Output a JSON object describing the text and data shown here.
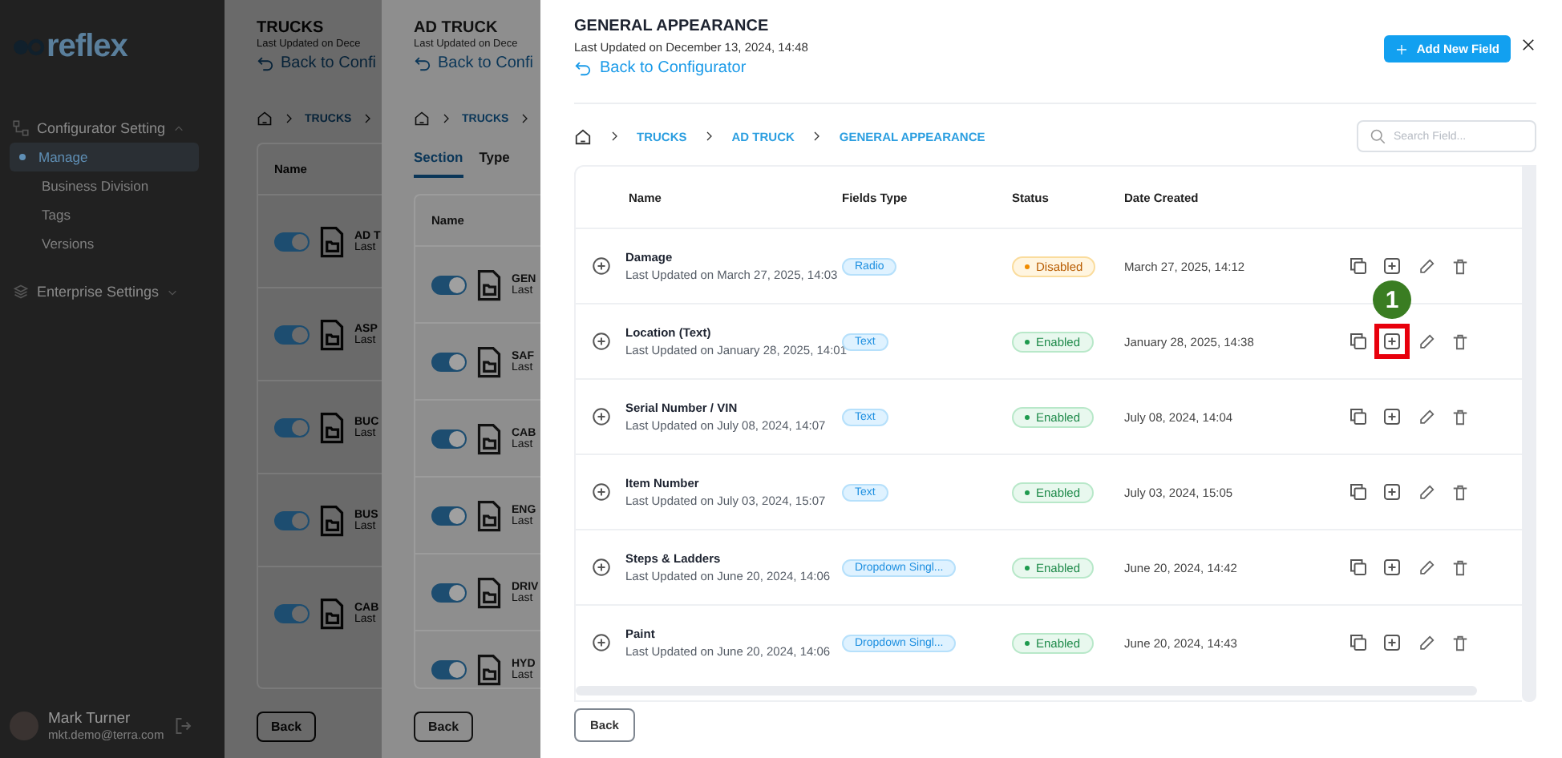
{
  "sidebar": {
    "logo_text": "reflex",
    "groups": [
      {
        "label": "Configurator Setting",
        "expanded": true,
        "items": [
          {
            "label": "Manage",
            "selected": true
          },
          {
            "label": "Business Division",
            "selected": false
          },
          {
            "label": "Tags",
            "selected": false
          },
          {
            "label": "Versions",
            "selected": false
          }
        ]
      },
      {
        "label": "Enterprise Settings",
        "expanded": false
      }
    ],
    "user": {
      "name": "Mark Turner",
      "email": "mkt.demo@terra.com"
    }
  },
  "back_panels": [
    {
      "title": "TRUCKS",
      "subtitle": "Last Updated on Dece",
      "back_link": "Back to Confi",
      "breadcrumb": [
        "TRUCKS"
      ],
      "column": "Name",
      "rows": [
        {
          "name": "AD T",
          "sub": "Last",
          "on": true
        },
        {
          "name": "ASP",
          "sub": "Last",
          "on": true
        },
        {
          "name": "BUC",
          "sub": "Last",
          "on": true
        },
        {
          "name": "BUS",
          "sub": "Last",
          "on": true
        },
        {
          "name": "CAB",
          "sub": "Last",
          "on": true
        }
      ],
      "back_button": "Back"
    },
    {
      "title": "AD TRUCK",
      "subtitle": "Last Updated on Dece",
      "back_link": "Back to Confi",
      "breadcrumb": [
        "TRUCKS"
      ],
      "tabs": [
        {
          "label": "Section",
          "selected": true
        },
        {
          "label": "Type",
          "selected": false
        }
      ],
      "column": "Name",
      "rows": [
        {
          "name": "GEN",
          "sub": "Last",
          "on": true
        },
        {
          "name": "SAF",
          "sub": "Last",
          "on": true
        },
        {
          "name": "CAB",
          "sub": "Last",
          "on": true
        },
        {
          "name": "ENG",
          "sub": "Last",
          "on": true
        },
        {
          "name": "DRIV",
          "sub": "Last",
          "on": true
        },
        {
          "name": "HYD",
          "sub": "Last",
          "on": true
        }
      ],
      "back_button": "Back"
    }
  ],
  "main": {
    "title": "GENERAL APPEARANCE",
    "subtitle": "Last Updated on December 13, 2024, 14:48",
    "back_link": "Back to Configurator",
    "add_button": "Add New Field",
    "breadcrumb": [
      "TRUCKS",
      "AD TRUCK",
      "GENERAL APPEARANCE"
    ],
    "search": {
      "placeholder": "Search Field..."
    },
    "columns": [
      "Name",
      "Fields Type",
      "Status",
      "Date Created"
    ],
    "rows": [
      {
        "name": "Damage",
        "updated": "Last Updated on March 27, 2025, 14:03",
        "type": "Radio",
        "status": "Disabled",
        "kind": "disabled",
        "created": "March 27, 2025, 14:12"
      },
      {
        "name": "Location (Text)",
        "updated": "Last Updated on January 28, 2025, 14:01",
        "type": "Text",
        "status": "Enabled",
        "kind": "enabled",
        "created": "January 28, 2025, 14:38",
        "callout": "1"
      },
      {
        "name": "Serial Number / VIN",
        "updated": "Last Updated on July 08, 2024, 14:07",
        "type": "Text",
        "status": "Enabled",
        "kind": "enabled",
        "created": "July 08, 2024, 14:04"
      },
      {
        "name": "Item Number",
        "updated": "Last Updated on July 03, 2024, 15:07",
        "type": "Text",
        "status": "Enabled",
        "kind": "enabled",
        "created": "July 03, 2024, 15:05"
      },
      {
        "name": "Steps & Ladders",
        "updated": "Last Updated on June 20, 2024, 14:06",
        "type": "Dropdown Singl...",
        "status": "Enabled",
        "kind": "enabled",
        "created": "June 20, 2024, 14:42"
      },
      {
        "name": "Paint",
        "updated": "Last Updated on June 20, 2024, 14:06",
        "type": "Dropdown Singl...",
        "status": "Enabled",
        "kind": "enabled",
        "created": "June 20, 2024, 14:43"
      }
    ],
    "back_button": "Back"
  }
}
